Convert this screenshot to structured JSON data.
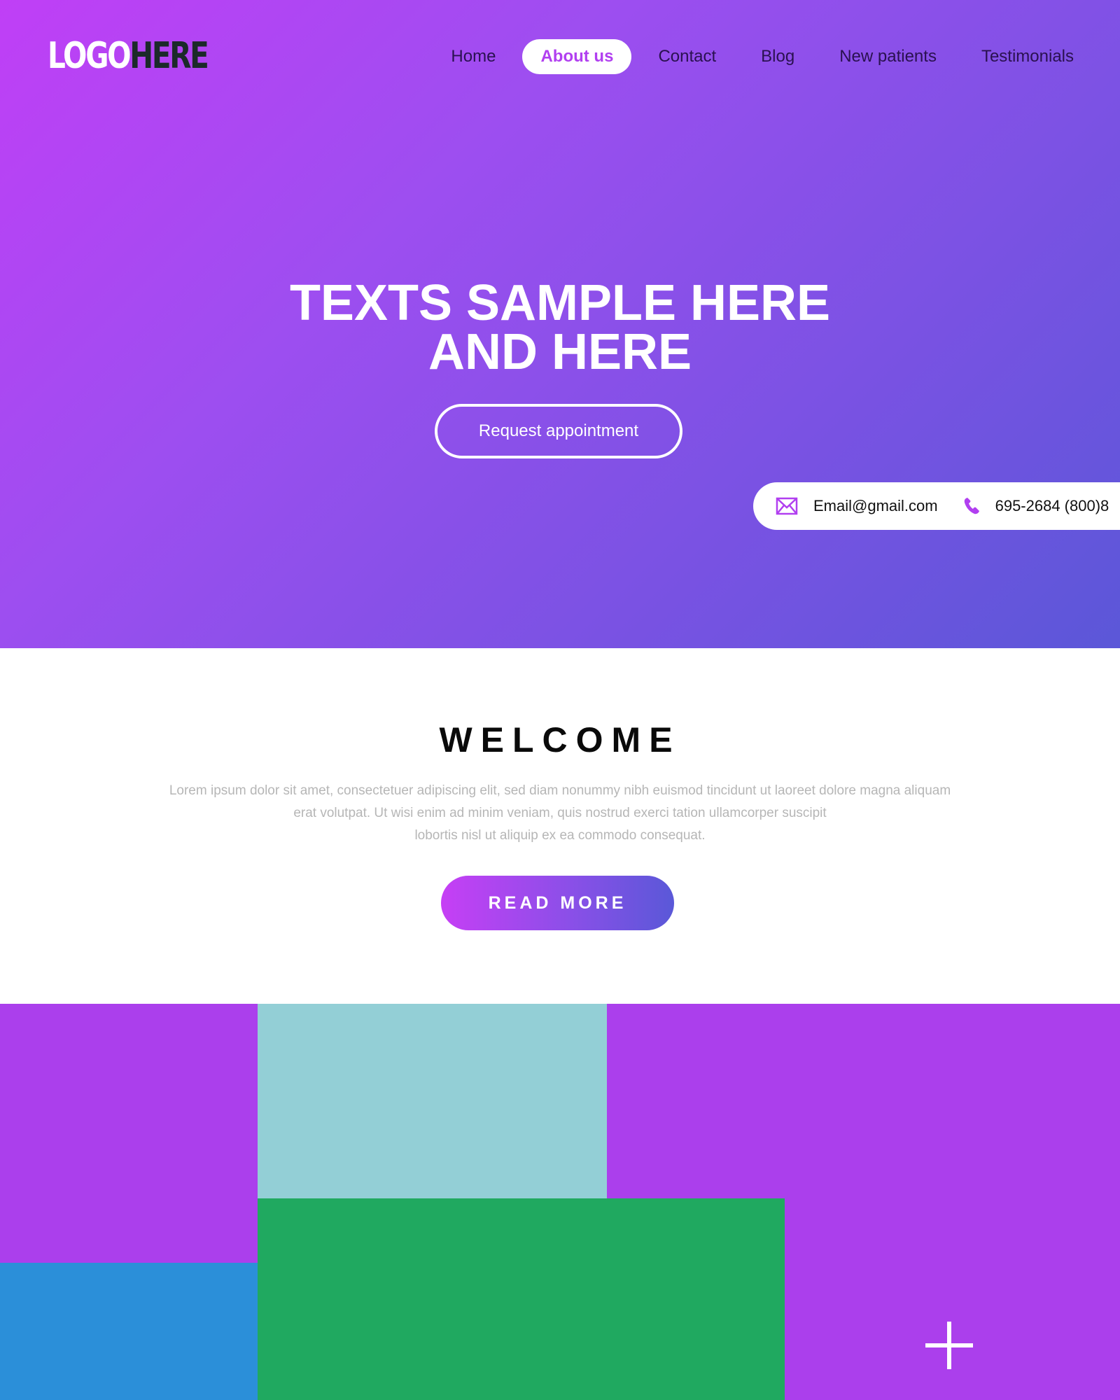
{
  "logo": {
    "part_a": "LOGO",
    "part_b": "HERE"
  },
  "nav": {
    "items": [
      {
        "label": "Home"
      },
      {
        "label": "About us"
      },
      {
        "label": "Contact"
      },
      {
        "label": "Blog"
      },
      {
        "label": "New patients"
      },
      {
        "label": "Testimonials"
      }
    ],
    "active_item": "About us"
  },
  "hero": {
    "title_line1": "TEXTS SAMPLE HERE",
    "title_line2": "AND HERE",
    "cta_label": "Request appointment"
  },
  "contact": {
    "email": "Email@gmail.com",
    "email_icon": "envelope-icon",
    "phone": "695-2684 (800)8",
    "phone_icon": "phone-icon"
  },
  "welcome": {
    "title": "WELCOME",
    "body_line1": "Lorem ipsum dolor sit amet, consectetuer adipiscing elit, sed diam nonummy nibh euismod tincidunt ut laoreet dolore magna aliquam",
    "body_line2": "erat volutpat. Ut wisi enim ad minim veniam, quis nostrud exerci tation ullamcorper suscipit",
    "body_line3": "lobortis nisl ut aliquip ex ea commodo consequat.",
    "read_more_label": "READ MORE"
  },
  "colors": {
    "accent": "#b13ff0",
    "hero_gradient_start": "#c03ff6",
    "hero_gradient_end": "#5b57d8",
    "block_purple": "#ab3fec",
    "block_teal": "#93cfd6",
    "block_green": "#20a960",
    "block_blue": "#2b8fd9"
  },
  "plus_icon": "plus-icon"
}
